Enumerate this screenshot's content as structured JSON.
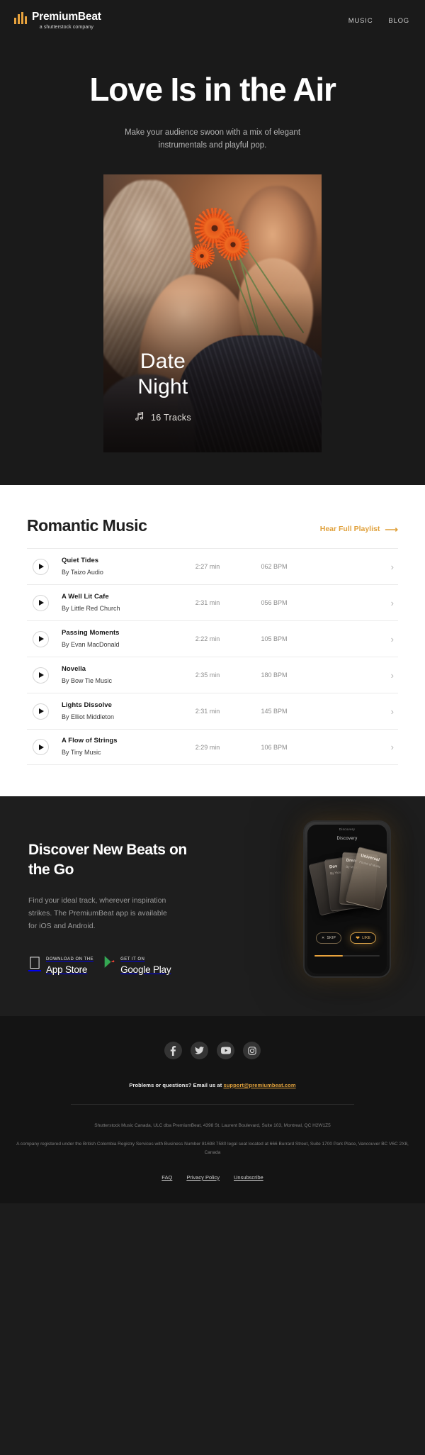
{
  "header": {
    "brand_name": "PremiumBeat",
    "brand_tagline": "a shutterstock company",
    "logo_icon": "equalizer-bars-icon",
    "accent_color": "#e8a33d",
    "nav": [
      {
        "label": "MUSIC"
      },
      {
        "label": "BLOG"
      }
    ]
  },
  "hero": {
    "title": "Love Is in the Air",
    "subtitle": "Make your audience swoon with a mix of elegant instrumentals and playful pop.",
    "artwork": {
      "title_line1": "Date",
      "title_line2": "Night",
      "tracks_label": "16 Tracks",
      "tracks_icon": "music-note-icon"
    }
  },
  "playlist": {
    "title": "Romantic Music",
    "link_label": "Hear Full Playlist",
    "link_icon": "arrow-right-icon",
    "play_icon": "play-icon",
    "chevron_icon": "chevron-right-icon",
    "tracks": [
      {
        "name": "Quiet Tides",
        "artist": "By Taizo Audio",
        "duration": "2:27 min",
        "bpm": "062 BPM"
      },
      {
        "name": "A Well Lit Cafe",
        "artist": "By Little Red Church",
        "duration": "2:31 min",
        "bpm": "056 BPM"
      },
      {
        "name": "Passing Moments",
        "artist": "By Evan MacDonald",
        "duration": "2:22 min",
        "bpm": "105 BPM"
      },
      {
        "name": "Novella",
        "artist": "By Bow Tie Music",
        "duration": "2:35 min",
        "bpm": "180 BPM"
      },
      {
        "name": "Lights Dissolve",
        "artist": "By Elliot Middleton",
        "duration": "2:31 min",
        "bpm": "145 BPM"
      },
      {
        "name": "A Flow of Strings",
        "artist": "By Tiny Music",
        "duration": "2:29 min",
        "bpm": "106 BPM"
      }
    ]
  },
  "promo": {
    "title": "Discover New Beats on the Go",
    "body": "Find your ideal track, wherever inspiration strikes. The PremiumBeat app is available for iOS and Android.",
    "app_store": {
      "small": "Download on the",
      "big": "App Store",
      "icon": "apple-icon"
    },
    "google_play": {
      "small": "GET IT ON",
      "big": "Google Play",
      "icon": "google-play-icon"
    },
    "phone": {
      "status": "Discovery",
      "header": "Discovery",
      "cards": [
        {
          "title": "Dov",
          "sub": "By Ylos"
        },
        {
          "title": "Drear",
          "sub": "By Mood"
        },
        {
          "title": "Universal",
          "sub": "Found of Music"
        }
      ],
      "pills": [
        {
          "label": "SKIP",
          "icon": "close-icon"
        },
        {
          "label": "LIKE",
          "icon": "heart-icon"
        }
      ]
    }
  },
  "footer": {
    "socials": [
      {
        "name": "facebook-icon"
      },
      {
        "name": "twitter-icon"
      },
      {
        "name": "youtube-icon"
      },
      {
        "name": "instagram-icon"
      }
    ],
    "contact_prefix": "Problems or questions? Email us at ",
    "contact_email": "support@premiumbeat.com",
    "legal_1": "Shutterstock Music Canada, ULC dba PremiumBeat, 4398 St. Laurent Boulevard, Suite 103, Montreal, QC H2W1Z5",
    "legal_2": "A company registered under the British Colombia Registry Services with Business Number 81698 7580 legal seat located at 666 Burrard Street, Suite 1700 Park Place, Vancouver BC V6C 2X8, Canada",
    "links": [
      {
        "label": "FAQ"
      },
      {
        "label": "Privacy Policy"
      },
      {
        "label": "Unsubscribe"
      }
    ]
  }
}
